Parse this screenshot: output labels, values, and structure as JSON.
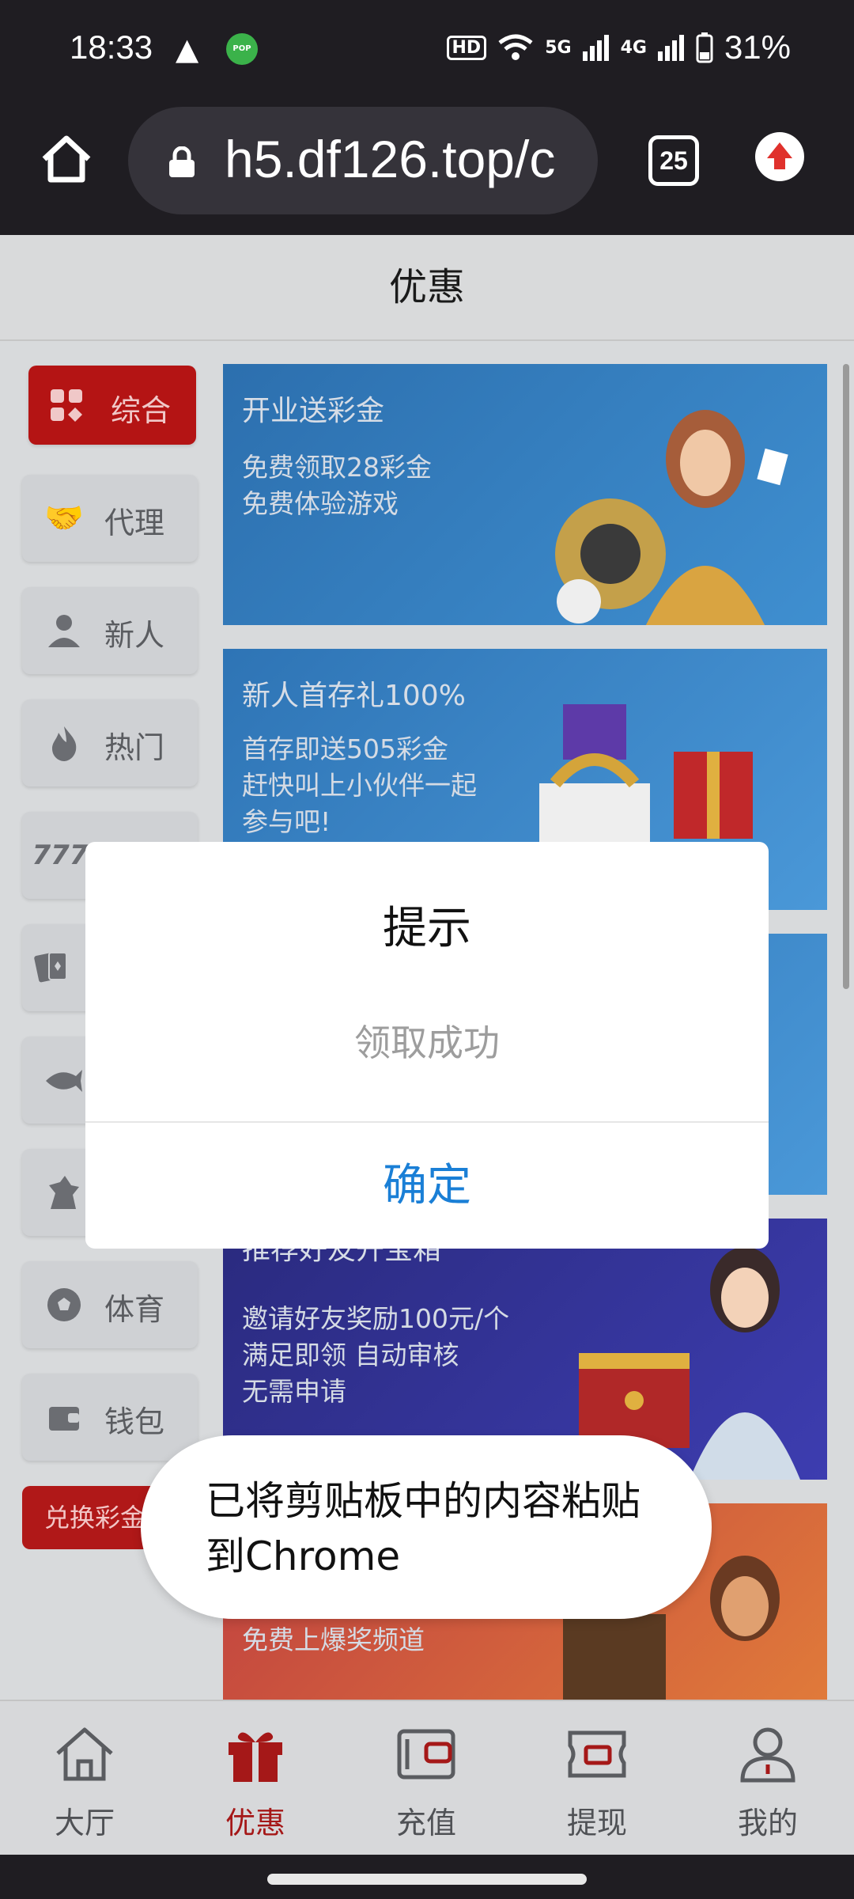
{
  "status_bar": {
    "time": "18:33",
    "warning_icon": "warning-icon",
    "pop_badge": "POP",
    "hd_label": "HD",
    "network_5g": "5G",
    "network_4g": "4G",
    "battery": "31%"
  },
  "browser": {
    "url": "h5.df126.top/c",
    "tab_count": "25"
  },
  "page": {
    "title": "优惠"
  },
  "sidebar": {
    "items": [
      {
        "label": "综合",
        "icon": "grid-icon"
      },
      {
        "label": "代理",
        "icon": "handshake-icon"
      },
      {
        "label": "新人",
        "icon": "person-icon"
      },
      {
        "label": "热门",
        "icon": "flame-icon"
      },
      {
        "label": "",
        "icon": "slot-777-icon"
      },
      {
        "label": "",
        "icon": "cards-icon"
      },
      {
        "label": "",
        "icon": "fish-icon"
      },
      {
        "label": "",
        "icon": "dragon-icon"
      },
      {
        "label": "体育",
        "icon": "soccer-icon"
      },
      {
        "label": "钱包",
        "icon": "wallet-icon"
      }
    ],
    "redeem_button": "兑换彩金"
  },
  "banners": [
    {
      "title": "开业送彩金",
      "lines": [
        "免费领取28彩金",
        "免费体验游戏"
      ],
      "color": "#2d78b8"
    },
    {
      "title": "新人首存礼100%",
      "lines": [
        "首存即送505彩金",
        "赶快叫上小伙伴一起",
        "参与吧!"
      ],
      "color": "#2f7cbc"
    },
    {
      "title": "",
      "lines": [],
      "color": "#2f7cbc"
    },
    {
      "title": "推荐好友开宝箱",
      "lines": [
        "邀请好友奖励100元/个",
        "满足即领 自动审核",
        "无需申请"
      ],
      "color": "#2a2a8c"
    },
    {
      "title": "",
      "lines": [
        "免费上爆奖频道"
      ],
      "color": "#b83a3a"
    }
  ],
  "dialog": {
    "title": "提示",
    "message": "领取成功",
    "ok": "确定"
  },
  "toast": {
    "text": "已将剪贴板中的内容粘贴到Chrome"
  },
  "bottom_nav": [
    {
      "label": "大厅",
      "icon": "home-icon"
    },
    {
      "label": "优惠",
      "icon": "gift-icon",
      "active": true
    },
    {
      "label": "充值",
      "icon": "wallet-icon"
    },
    {
      "label": "提现",
      "icon": "cash-icon"
    },
    {
      "label": "我的",
      "icon": "user-icon"
    }
  ]
}
